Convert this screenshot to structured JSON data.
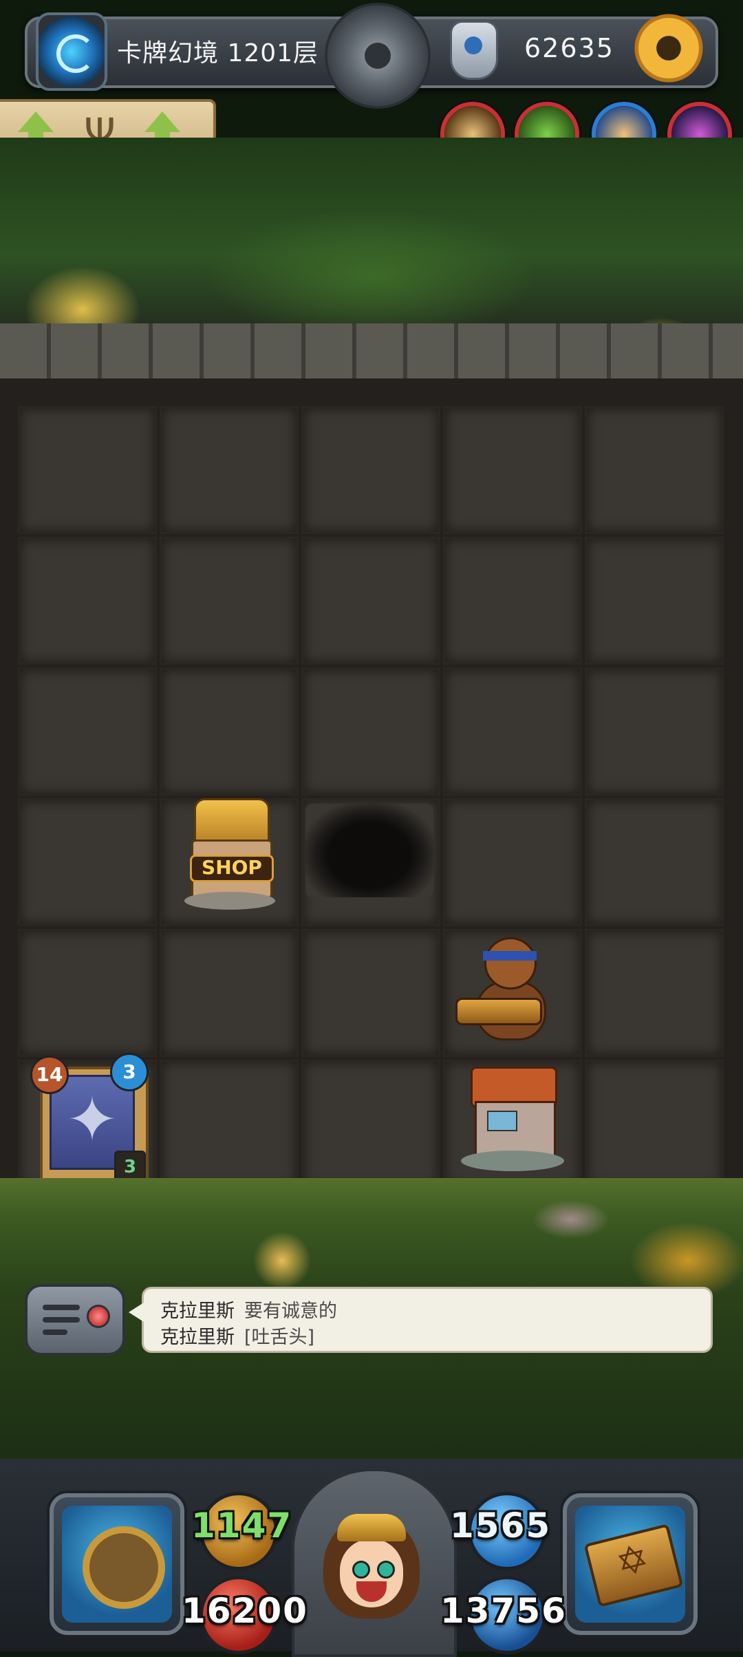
{
  "topbar": {
    "title": "卡牌幻境 1201层",
    "gold": "62635",
    "portal_icon": "portal-icon",
    "center_icon": "bomb-disc-icon",
    "currency_icon": "shield-crest-icon",
    "settings_icon": "gear-icon"
  },
  "tome": {
    "left_icon": "arrow-up-icon",
    "center_icon": "candelabra-icon",
    "right_icon": "arrow-up-icon"
  },
  "status_avatars": [
    {
      "name": "hammer",
      "ring": "#c93034"
    },
    {
      "name": "goblin",
      "ring": "#c93034"
    },
    {
      "name": "hero",
      "ring": "#2b7fd3"
    },
    {
      "name": "wraith",
      "ring": "#c93034"
    }
  ],
  "board": {
    "columns": 5,
    "rows": 6,
    "shop_label": "SHOP",
    "deck": {
      "attack": "14",
      "defense": "3",
      "count": "3"
    }
  },
  "chat": {
    "lines": [
      {
        "name": "克拉里斯",
        "message": "要有诚意的"
      },
      {
        "name": "克拉里斯",
        "message": "[吐舌头]"
      }
    ]
  },
  "hud": {
    "attack": "1147",
    "defense": "1565",
    "hp": "16200",
    "mana": "13756",
    "colors": {
      "attack": "#7ee06a",
      "defense": "#eef6ff"
    }
  }
}
